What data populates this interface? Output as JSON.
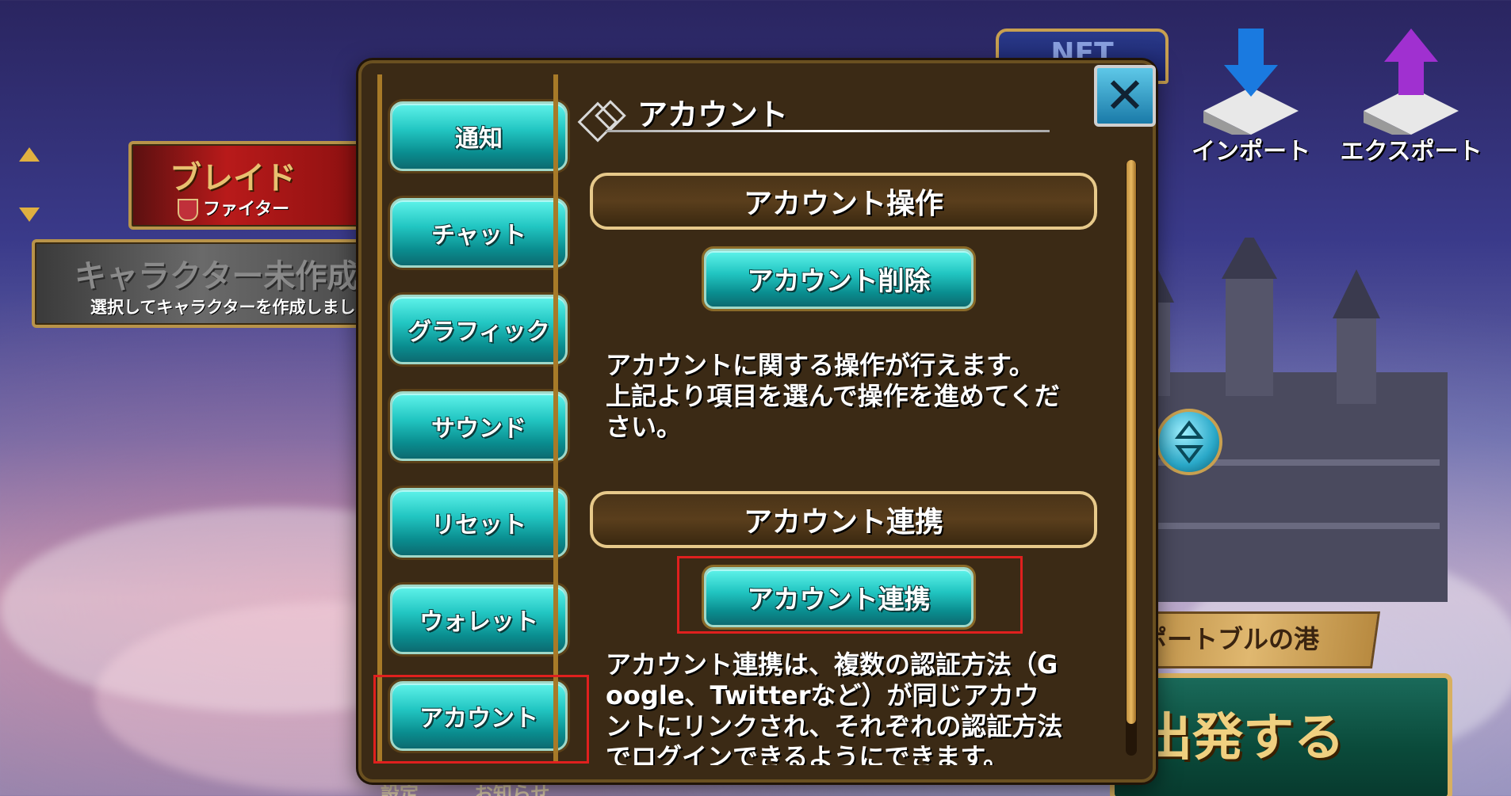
{
  "background": {
    "characters": [
      {
        "name": "ブレイド",
        "class": "ファイター"
      },
      {
        "name": "キャラクター未作成",
        "hint": "選択してキャラクターを作成しまし"
      }
    ],
    "net_badge": "NET",
    "import_label": "インポート",
    "export_label": "エクスポート",
    "location": "ポートブルの港",
    "depart_label": "出発する",
    "bottom_left_label": "設定",
    "bottom_right_label": "お知らせ"
  },
  "modal": {
    "nav": [
      {
        "label": "通知"
      },
      {
        "label": "チャット"
      },
      {
        "label": "グラフィック"
      },
      {
        "label": "サウンド"
      },
      {
        "label": "リセット"
      },
      {
        "label": "ウォレット"
      },
      {
        "label": "アカウント"
      }
    ],
    "title": "アカウント",
    "close_symbol": "✕",
    "sections": [
      {
        "header": "アカウント操作",
        "button": "アカウント削除",
        "description": [
          "アカウントに関する操作が行えます。",
          "上記より項目を選んで操作を進めてくだ",
          "さい。"
        ]
      },
      {
        "header": "アカウント連携",
        "button": "アカウント連携",
        "description": [
          "アカウント連携は、複数の認証方法（G",
          "oogle、Twitterなど）が同じアカウ",
          "ントにリンクされ、それぞれの認証方法",
          "でログインできるようにできます。"
        ]
      }
    ]
  },
  "colors": {
    "modal_bg": "#3b2a15",
    "button_teal": "#22c6c2",
    "highlight_red": "#e0201e",
    "gold_border": "#e7c98a"
  }
}
